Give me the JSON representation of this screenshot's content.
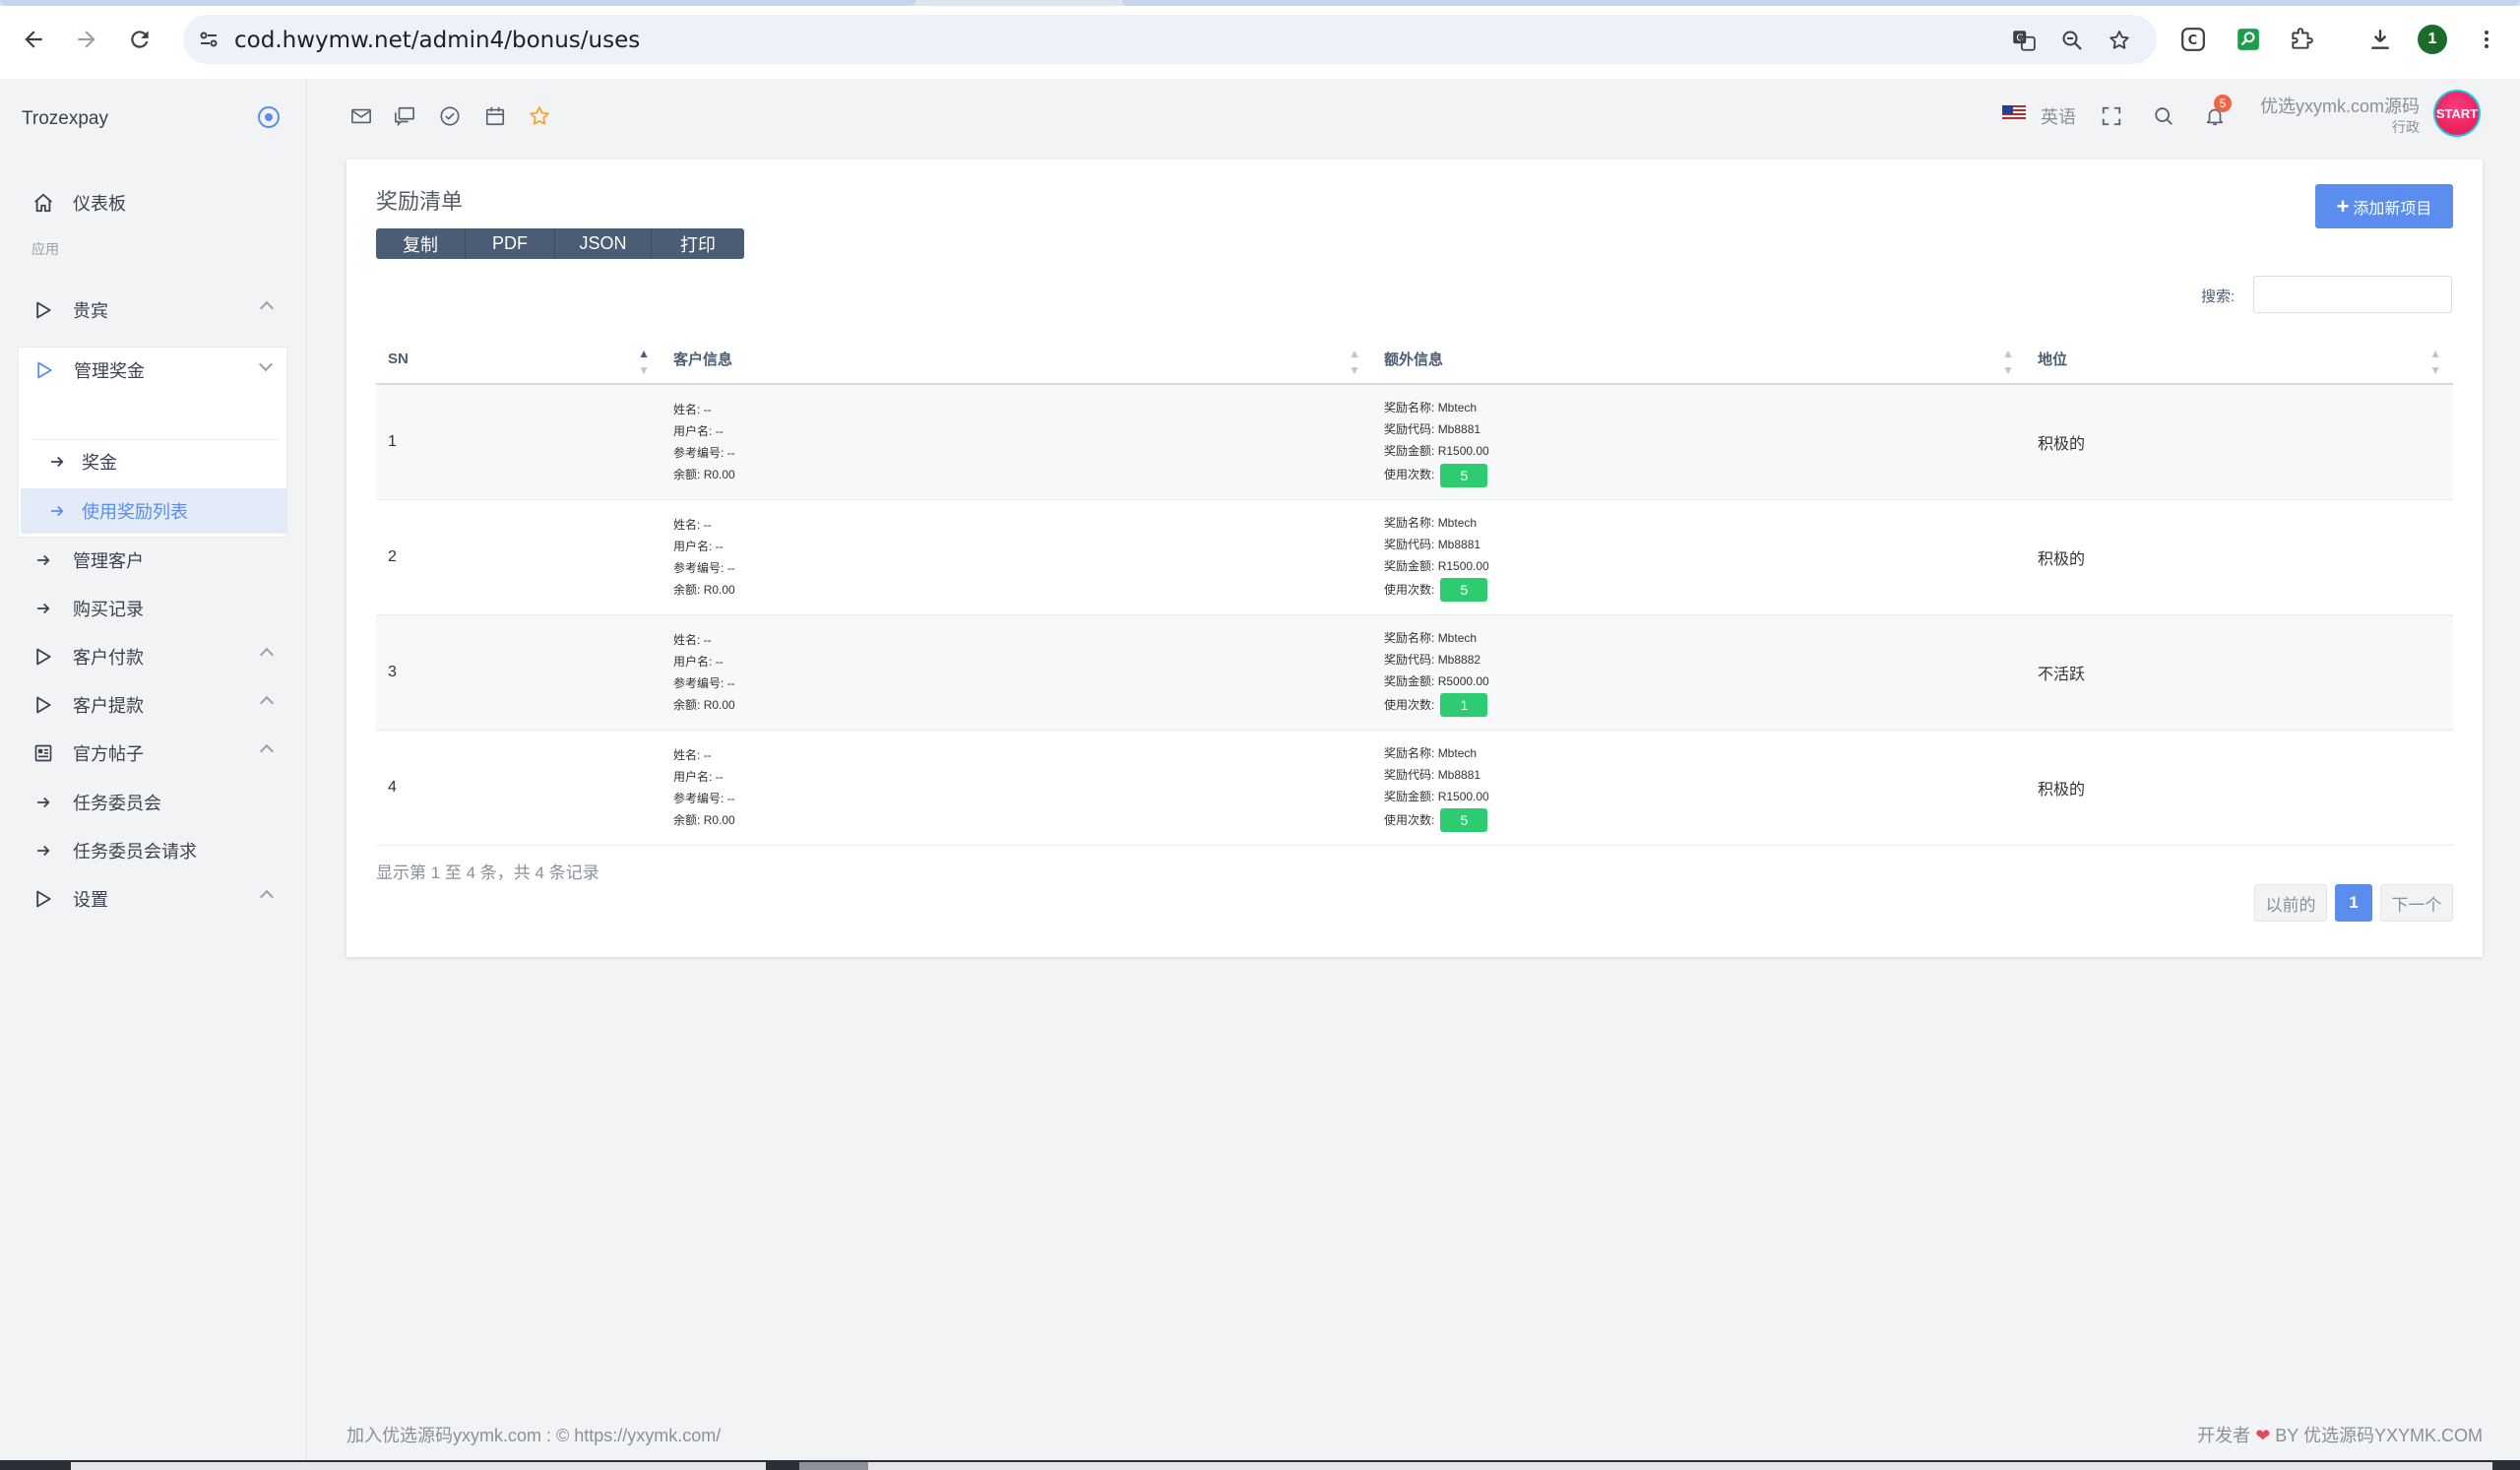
{
  "browser": {
    "url": "cod.hwymw.net/admin4/bonus/uses",
    "profile_initial": "1"
  },
  "sidebar": {
    "brand": "Trozexpay",
    "group_label": "应用",
    "items": [
      {
        "label": "仪表板"
      },
      {
        "label": "贵宾"
      },
      {
        "label": "管理奖金"
      },
      {
        "label": "奖金"
      },
      {
        "label": "使用奖励列表"
      },
      {
        "label": "管理客户"
      },
      {
        "label": "购买记录"
      },
      {
        "label": "客户付款"
      },
      {
        "label": "客户提款"
      },
      {
        "label": "官方帖子"
      },
      {
        "label": "任务委员会"
      },
      {
        "label": "任务委员会请求"
      },
      {
        "label": "设置"
      }
    ]
  },
  "topbar": {
    "language": "英语",
    "notification_count": "5",
    "user_name": "优选yxymk.com源码",
    "user_role": "行政",
    "avatar_text": "START"
  },
  "card": {
    "title": "奖励清单",
    "add_button": "添加新项目",
    "export_buttons": [
      "复制",
      "PDF",
      "JSON",
      "打印"
    ],
    "search_label": "搜索:",
    "columns": [
      "SN",
      "客户信息",
      "额外信息",
      "地位"
    ],
    "customer_labels": {
      "name": "姓名:",
      "username": "用户名:",
      "ref": "参考编号:",
      "balance": "余额:"
    },
    "extra_labels": {
      "bonus_name": "奖励名称:",
      "bonus_code": "奖励代码:",
      "bonus_amount": "奖励金额:",
      "uses": "使用次数:"
    },
    "rows": [
      {
        "sn": "1",
        "name": "--",
        "username": "--",
        "ref": "--",
        "balance": "R0.00",
        "bonus_name": "Mbtech",
        "bonus_code": "Mb8881",
        "bonus_amount": "R1500.00",
        "uses": "5",
        "status": "积极的"
      },
      {
        "sn": "2",
        "name": "--",
        "username": "--",
        "ref": "--",
        "balance": "R0.00",
        "bonus_name": "Mbtech",
        "bonus_code": "Mb8881",
        "bonus_amount": "R1500.00",
        "uses": "5",
        "status": "积极的"
      },
      {
        "sn": "3",
        "name": "--",
        "username": "--",
        "ref": "--",
        "balance": "R0.00",
        "bonus_name": "Mbtech",
        "bonus_code": "Mb8882",
        "bonus_amount": "R5000.00",
        "uses": "1",
        "status": "不活跃"
      },
      {
        "sn": "4",
        "name": "--",
        "username": "--",
        "ref": "--",
        "balance": "R0.00",
        "bonus_name": "Mbtech",
        "bonus_code": "Mb8881",
        "bonus_amount": "R1500.00",
        "uses": "5",
        "status": "积极的"
      }
    ],
    "table_info": "显示第 1 至 4 条，共 4 条记录",
    "pagination": {
      "prev": "以前的",
      "current": "1",
      "next": "下一个"
    }
  },
  "footer": {
    "left": "加入优选源码yxymk.com : © https://yxymk.com/",
    "right_prefix": "开发者",
    "right_suffix": "BY 优选源码YXYMK.COM"
  },
  "colors": {
    "accent": "#5b8def",
    "badge_green": "#2ecc71",
    "export_bg": "#4b5d74",
    "notif": "#f06548"
  }
}
